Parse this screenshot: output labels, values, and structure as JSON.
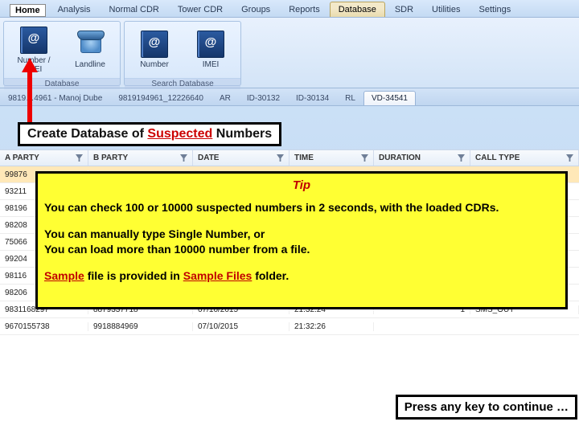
{
  "menu": {
    "home": "Home",
    "tabs": [
      "Analysis",
      "Normal CDR",
      "Tower CDR",
      "Groups",
      "Reports",
      "Database",
      "SDR",
      "Utilities",
      "Settings"
    ],
    "activeIndex": 5
  },
  "ribbon": {
    "group1": {
      "title": "Database",
      "btn1": "Number / IMEI",
      "btn2": "Landline"
    },
    "group2": {
      "title": "Search Database",
      "btn1": "Number",
      "btn2": "IMEI"
    }
  },
  "docTabs": {
    "tabs": [
      "9819…4961 - Manoj Dube",
      "9819194961_12226640",
      "AR",
      "ID-30132",
      "ID-30134",
      "RL",
      "VD-34541"
    ],
    "activeIndex": 6
  },
  "banner": {
    "pre": "Create Database of ",
    "sus": "Suspected",
    "post": " Numbers"
  },
  "grid": {
    "headers": [
      "A PARTY",
      "B PARTY",
      "DATE",
      "TIME",
      "DURATION",
      "CALL TYPE"
    ],
    "rows": [
      {
        "a": "99876",
        "b": "",
        "d": "",
        "t": "",
        "dur": "",
        "ct": "",
        "sel": true
      },
      {
        "a": "93211",
        "b": "",
        "d": "",
        "t": "",
        "dur": "",
        "ct": ""
      },
      {
        "a": "98196",
        "b": "",
        "d": "",
        "t": "",
        "dur": "",
        "ct": ""
      },
      {
        "a": "98208",
        "b": "",
        "d": "",
        "t": "",
        "dur": "",
        "ct": ""
      },
      {
        "a": "75066",
        "b": "",
        "d": "",
        "t": "",
        "dur": "",
        "ct": ""
      },
      {
        "a": "99204",
        "b": "",
        "d": "",
        "t": "",
        "dur": "",
        "ct": ""
      },
      {
        "a": "98116",
        "b": "",
        "d": "",
        "t": "",
        "dur": "",
        "ct": ""
      },
      {
        "a": "98206",
        "b": "",
        "d": "",
        "t": "",
        "dur": "",
        "ct": ""
      },
      {
        "a": "9831168297",
        "b": "8879337718",
        "d": "07/10/2015",
        "t": "21:32:24",
        "dur": "1",
        "ct": "SMS_OUT"
      },
      {
        "a": "9670155738",
        "b": "9918884969",
        "d": "07/10/2015",
        "t": "21:32:26",
        "dur": "",
        "ct": ""
      }
    ]
  },
  "tip": {
    "title": "Tip",
    "line1": "You can check 100 or 10000 suspected numbers in 2 seconds, with the loaded CDRs.",
    "line2a": "You can manually type Single Number, or",
    "line2b": "You can load more than 10000 number from a file.",
    "line3_pre": "",
    "line3_s1": "Sample",
    "line3_mid": " file is provided in ",
    "line3_s2": "Sample Files",
    "line3_post": " folder."
  },
  "continue": "Press any key to continue …"
}
